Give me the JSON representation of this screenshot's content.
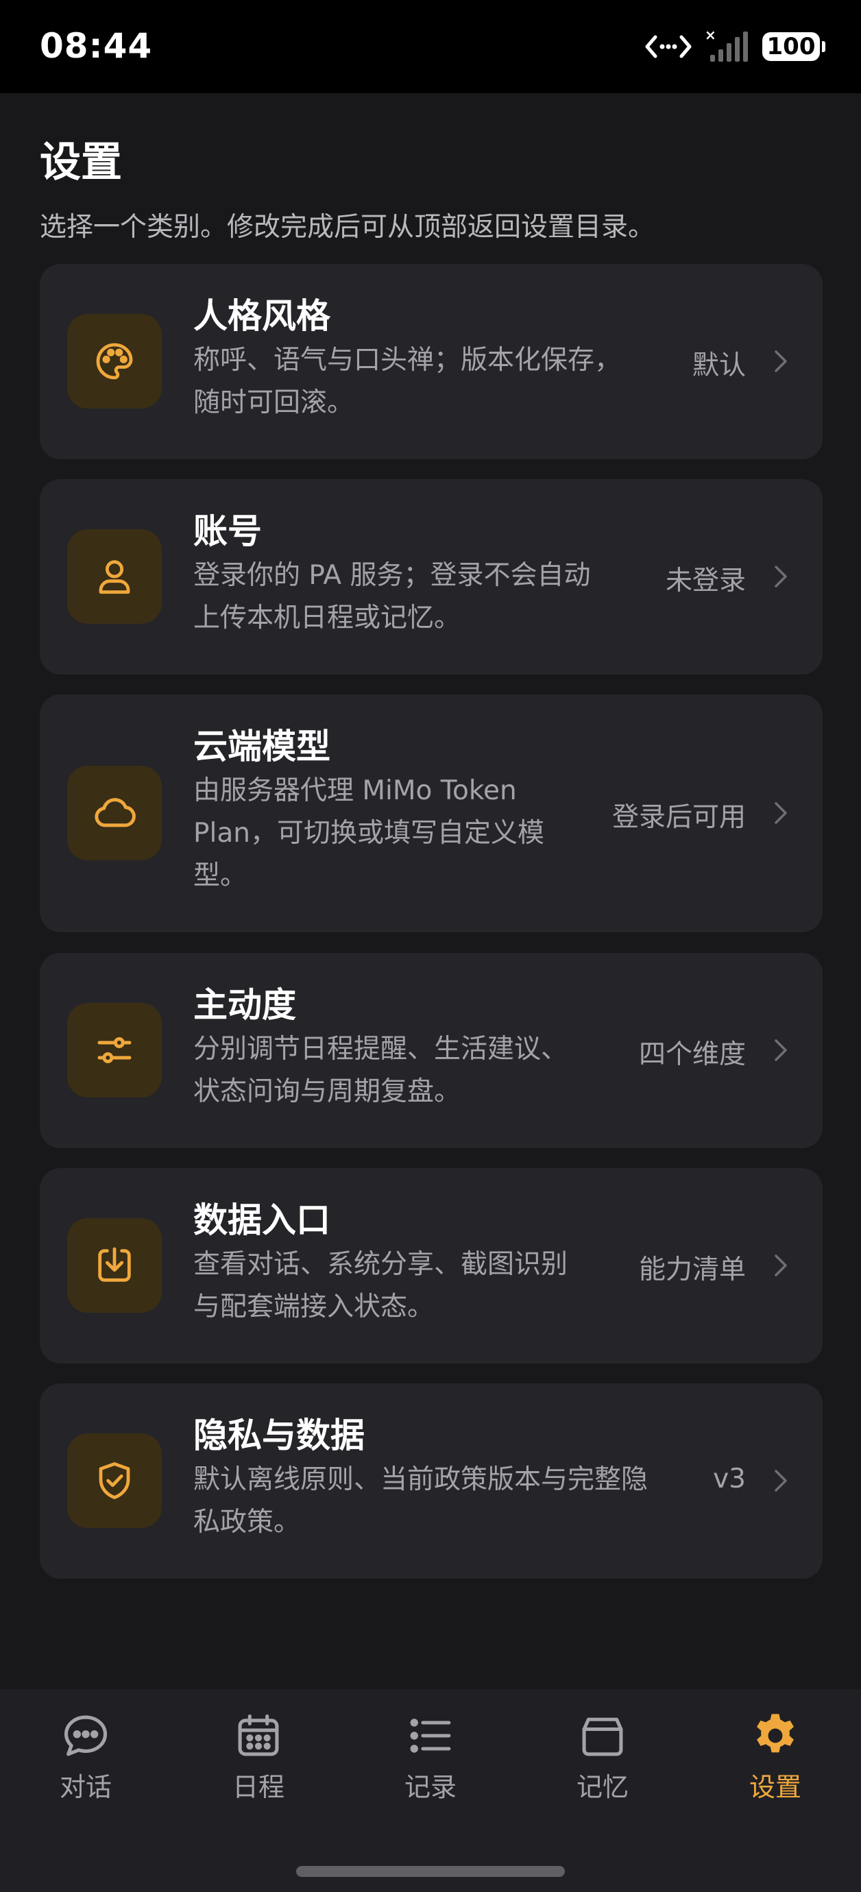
{
  "status_bar": {
    "time": "08:44",
    "battery": "100"
  },
  "page": {
    "title": "设置",
    "subtitle": "选择一个类别。修改完成后可从顶部返回设置目录。"
  },
  "settings": [
    {
      "icon": "palette-icon",
      "title": "人格风格",
      "desc_lines": [
        "称呼、语气与口头禅；版本化保存，",
        "随时可回滚。"
      ],
      "value": "默认"
    },
    {
      "icon": "user-icon",
      "title": "账号",
      "desc_lines": [
        "登录你的 PA 服务；登录不会自动",
        "上传本机日程或记忆。"
      ],
      "value": "未登录"
    },
    {
      "icon": "cloud-icon",
      "title": "云端模型",
      "desc_lines": [
        "由服务器代理 MiMo Token",
        "Plan，可切换或填写自定义模",
        "型。"
      ],
      "value": "登录后可用"
    },
    {
      "icon": "sliders-icon",
      "title": "主动度",
      "desc_lines": [
        "分别调节日程提醒、生活建议、",
        "状态问询与周期复盘。"
      ],
      "value": "四个维度"
    },
    {
      "icon": "download-icon",
      "title": "数据入口",
      "desc_lines": [
        "查看对话、系统分享、截图识别",
        "与配套端接入状态。"
      ],
      "value": "能力清单"
    },
    {
      "icon": "shield-check-icon",
      "title": "隐私与数据",
      "desc_lines": [
        "默认离线原则、当前政策版本与完整隐",
        "私政策。"
      ],
      "value": "v3"
    }
  ],
  "tabs": [
    {
      "label": "对话",
      "icon": "chat-bubble-icon",
      "active": false
    },
    {
      "label": "日程",
      "icon": "calendar-icon",
      "active": false
    },
    {
      "label": "记录",
      "icon": "list-icon",
      "active": false
    },
    {
      "label": "记忆",
      "icon": "archive-box-icon",
      "active": false
    },
    {
      "label": "设置",
      "icon": "gear-icon",
      "active": true
    }
  ],
  "colors": {
    "accent": "#f0a83c",
    "background": "#18181b",
    "card": "#242429",
    "icon_tile": "#3a2e15"
  }
}
